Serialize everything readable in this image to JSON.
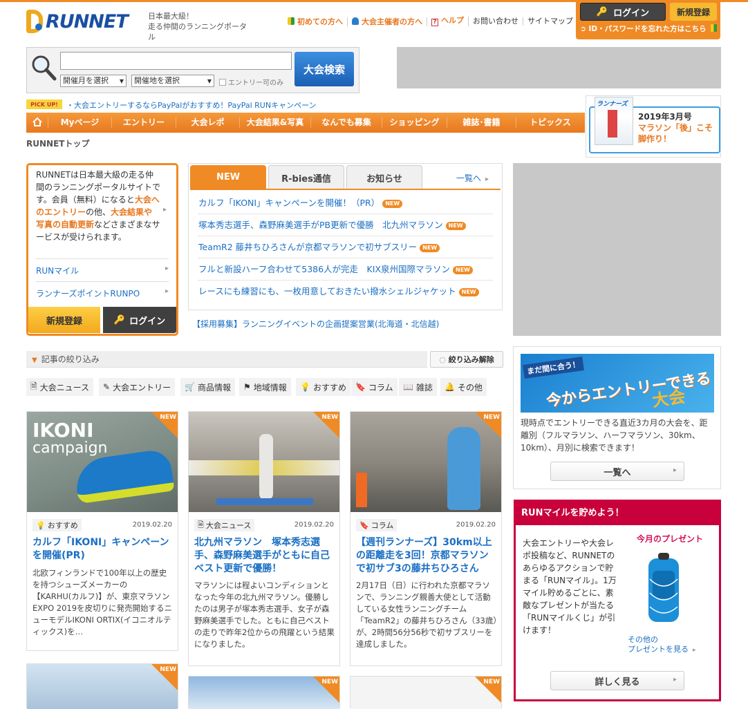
{
  "header": {
    "logo_text": "RUNNET",
    "tagline_1": "日本最大級！",
    "tagline_2": "走る仲間のランニングポータル",
    "nav": [
      "初めての方へ",
      "大会主催者の方へ",
      "ヘルプ",
      "お問い合わせ",
      "サイトマップ"
    ],
    "login_label": "ログイン",
    "register_label": "新規登録",
    "forgot_label": "ID・パスワードを忘れた方はこちら"
  },
  "search": {
    "placeholder": "",
    "month_select": "開催月を選択",
    "place_select": "開催地を選択",
    "entry_only_label": "エントリー可のみ",
    "button_label": "大会検索"
  },
  "pickup": {
    "badge": "PICK UP!",
    "text": "・大会エントリーするならPayPalがおすすめ！PayPal RUNキャンペーン"
  },
  "magazine": {
    "cover_title": "ランナーズ",
    "date": "2019年3月号",
    "title": "マラソン「後」こそ脚作り！"
  },
  "main_nav": [
    "Myページ",
    "エントリー",
    "大会レポ",
    "大会結果&写真",
    "なんでも募集",
    "ショッピング",
    "雑誌･書籍",
    "トピックス"
  ],
  "breadcrumb": "RUNNETトップ",
  "intro": {
    "text_1": "RUNNETは日本最大級の走る仲間のランニングポータルサイトです。会員（無料）になると",
    "text_highlight_1": "大会へのエントリー",
    "text_2": "の他、",
    "text_highlight_2": "大会結果や写真の自動更新",
    "text_3": "などさまざまなサービスが受けられます。",
    "links": [
      "RUNマイル",
      "ランナーズポイントRUNPO"
    ],
    "register_label": "新規登録",
    "login_label": "ログイン"
  },
  "news": {
    "tabs": [
      "NEW",
      "R-bies通信",
      "お知らせ"
    ],
    "more_label": "一覧へ",
    "badge": "NEW",
    "items": [
      "カルフ「IKONI」キャンペーンを開催！（PR）",
      "塚本秀志選手、森野麻美選手がPB更新で優勝　北九州マラソン",
      "TeamR2 藤井ちひろさんが京都マラソンで初サブスリー",
      "フルと新設ハーフ合わせて5386人が完走　KIX泉州国際マラソン",
      "レースにも練習にも、一枚用意しておきたい撥水シェルジャケット"
    ],
    "recruit": "【採用募集】ランニングイベントの企画提案営業(北海道・北信越)"
  },
  "filter": {
    "label": "記事の絞り込み",
    "reset_label": "絞り込み解除",
    "categories": [
      "大会ニュース",
      "大会エントリー",
      "商品情報",
      "地域情報",
      "おすすめ",
      "コラム",
      "雑誌",
      "その他"
    ]
  },
  "cards": [
    {
      "tag": "おすすめ",
      "date": "2019.02.20",
      "title": "カルフ「IKONI」キャンペーンを開催(PR)",
      "body": "北欧フィンランドで100年以上の歴史を持つシューズメーカーの【KARHU(カルフ)】が、東京マラソンEXPO 2019を皮切りに発売開始するニューモデルIKONI ORTIX(イコニオルティックス)を…",
      "image_text_1": "IKONI",
      "image_text_2": "campaign"
    },
    {
      "tag": "大会ニュース",
      "date": "2019.02.20",
      "title": "北九州マラソン　塚本秀志選手、森野麻美選手がともに自己ベスト更新で優勝！",
      "body": "マラソンには程よいコンディションとなった今年の北九州マラソン。優勝したのは男子が塚本秀志選手、女子が森野麻美選手でした。ともに自己ベストの走りで昨年2位からの飛躍という結果になりました。"
    },
    {
      "tag": "コラム",
      "date": "2019.02.20",
      "title": "【週刊ランナーズ】30km以上の距離走を3回！京都マラソンで初サブ3の藤井ちひろさん",
      "body": "2月17日（日）に行われた京都マラソンで、ランニング親善大使として活動している女性ランニングチーム「TeamR2」の藤井ちひろさん（33歳）が、2時間56分56秒で初サブスリーを達成しました。"
    }
  ],
  "card_new_label": "NEW",
  "entry_box": {
    "banner_1": "まだ間に合う！",
    "banner_2": "今からエントリーできる",
    "banner_3": "大会",
    "desc": "現時点でエントリーできる直近3カ月の大会を、距離別（フルマラソン、ハーフマラソン、30km、10km）、月別に検索できます！",
    "button": "一覧へ"
  },
  "mile_box": {
    "title": "RUNマイルを貯めよう！",
    "text": "大会エントリーや大会レポ投稿など、RUNNETのあらゆるアクションで貯まる「RUNマイル」。1万マイル貯めるごとに、素敵なプレゼントが当たる「RUNマイルくじ」が引けます！",
    "present_label": "今月のプレゼント",
    "present_more_1": "その他の",
    "present_more_2": "プレゼントを見る",
    "button": "詳しく見る"
  },
  "colors": {
    "accent": "#f08a24",
    "link": "#1a6fc4",
    "mile": "#c8003b"
  }
}
